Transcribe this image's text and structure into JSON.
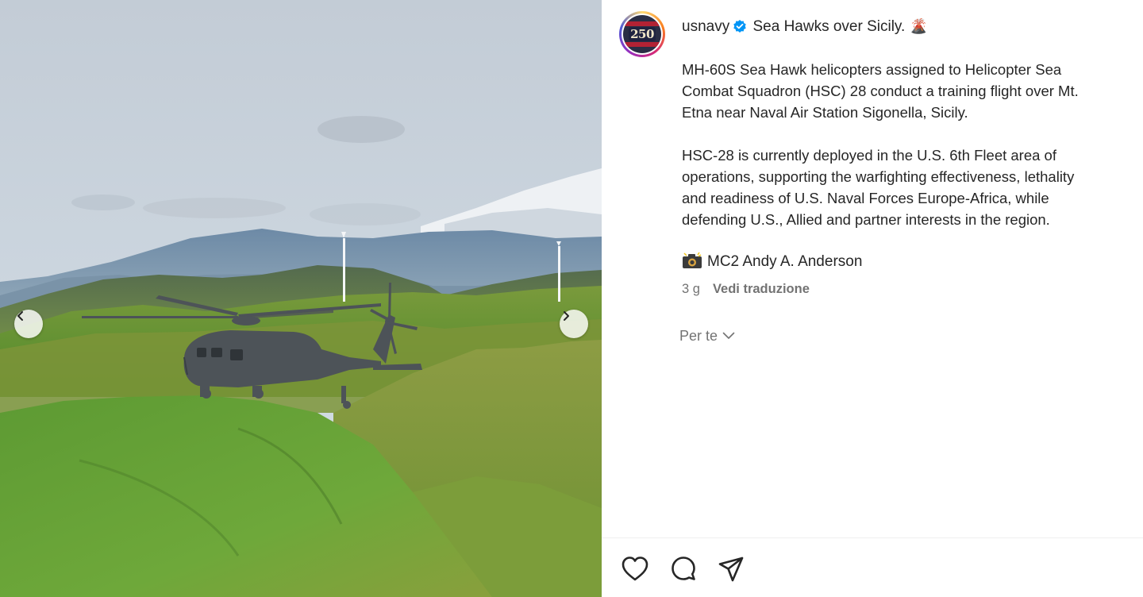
{
  "post": {
    "username": "usnavy",
    "title": "Sea Hawks over Sicily.",
    "title_emoji": "🌋",
    "avatar_text": "250",
    "caption_lines_1": [
      "MH-60S Sea Hawk helicopters assigned to Helicopter Sea",
      "Combat Squadron (HSC) 28 conduct a training flight over Mt.",
      "Etna near Naval Air Station Sigonella, Sicily."
    ],
    "caption_lines_2": [
      "HSC-28 is currently deployed in the U.S. 6th Fleet area of",
      "operations, supporting the warfighting effectiveness, lethality",
      "and readiness of U.S. Naval Forces Europe-Africa, while",
      "defending U.S., Allied and partner interests in the region."
    ],
    "credit": "MC2 Andy A. Anderson",
    "time_ago": "3 g",
    "translate_label": "Vedi traduzione",
    "for_you_label": "Per te"
  },
  "icons": {
    "verified": "verified-badge-icon",
    "credit": "camera-icon",
    "prev": "chevron-left-icon",
    "next": "chevron-right-icon",
    "dropdown": "chevron-down-icon",
    "like": "heart-icon",
    "comment": "comment-icon",
    "share": "paper-plane-icon"
  },
  "colors": {
    "verified": "#0095f6",
    "text": "#262626",
    "muted": "#737373"
  }
}
